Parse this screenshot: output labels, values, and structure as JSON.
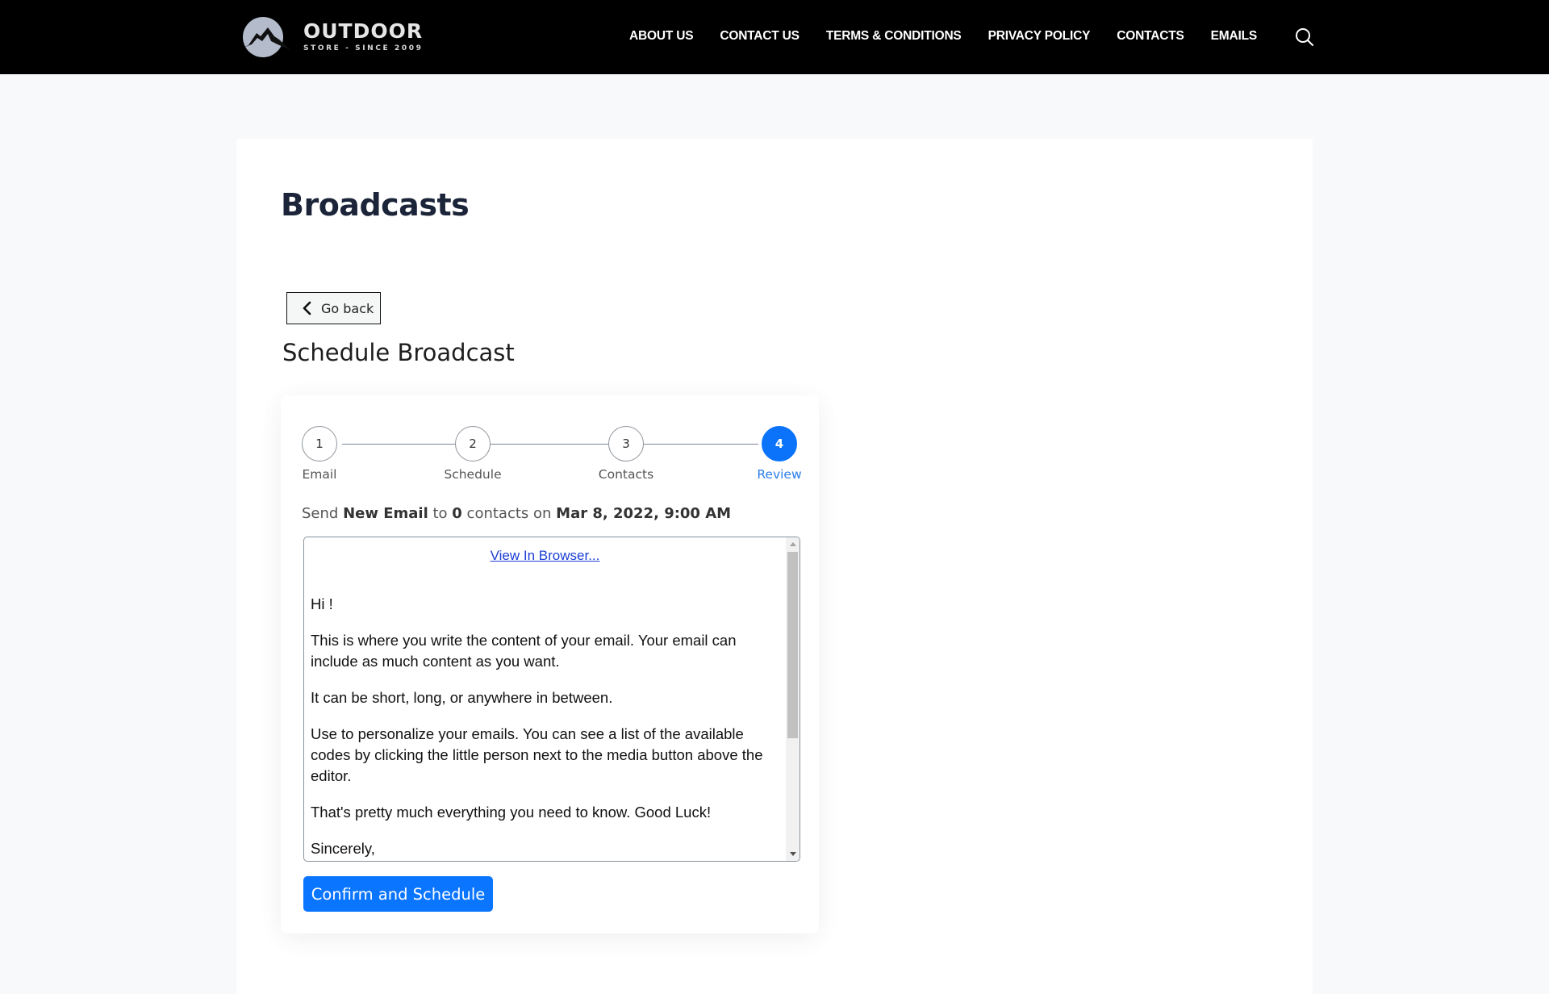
{
  "header": {
    "logo_title": "OUTDOOR",
    "logo_subtitle": "STORE - SINCE 2009",
    "nav": [
      {
        "label": "ABOUT US"
      },
      {
        "label": "CONTACT US"
      },
      {
        "label": "TERMS & CONDITIONS"
      },
      {
        "label": "PRIVACY POLICY"
      },
      {
        "label": "CONTACTS"
      },
      {
        "label": "EMAILS"
      }
    ],
    "search_icon": "search-icon"
  },
  "page": {
    "title": "Broadcasts",
    "back_label": "Go back",
    "subtitle": "Schedule Broadcast"
  },
  "stepper": {
    "steps": [
      {
        "number": "1",
        "label": "Email",
        "active": false
      },
      {
        "number": "2",
        "label": "Schedule",
        "active": false
      },
      {
        "number": "3",
        "label": "Contacts",
        "active": false
      },
      {
        "number": "4",
        "label": "Review",
        "active": true
      }
    ]
  },
  "summary": {
    "prefix": "Send ",
    "email_name": "New Email",
    "to": " to ",
    "count": "0",
    "contacts_on": " contacts on ",
    "datetime": "Mar 8, 2022, 9:00 AM"
  },
  "preview": {
    "view_in_browser": "View In Browser...",
    "paragraphs": [
      "Hi !",
      "This is where you write the content of your email. Your email can include as much content as you want.",
      "It can be short, long, or anywhere in between.",
      "Use to personalize your emails. You can see a list of the available codes by clicking the little person next to the media button above the editor.",
      "That's pretty much everything you need to know. Good Luck!",
      "Sincerely,"
    ]
  },
  "actions": {
    "confirm_label": "Confirm and Schedule"
  },
  "colors": {
    "accent": "#0a75ff",
    "header_bg": "#000000",
    "page_bg": "#f8f9fb"
  }
}
